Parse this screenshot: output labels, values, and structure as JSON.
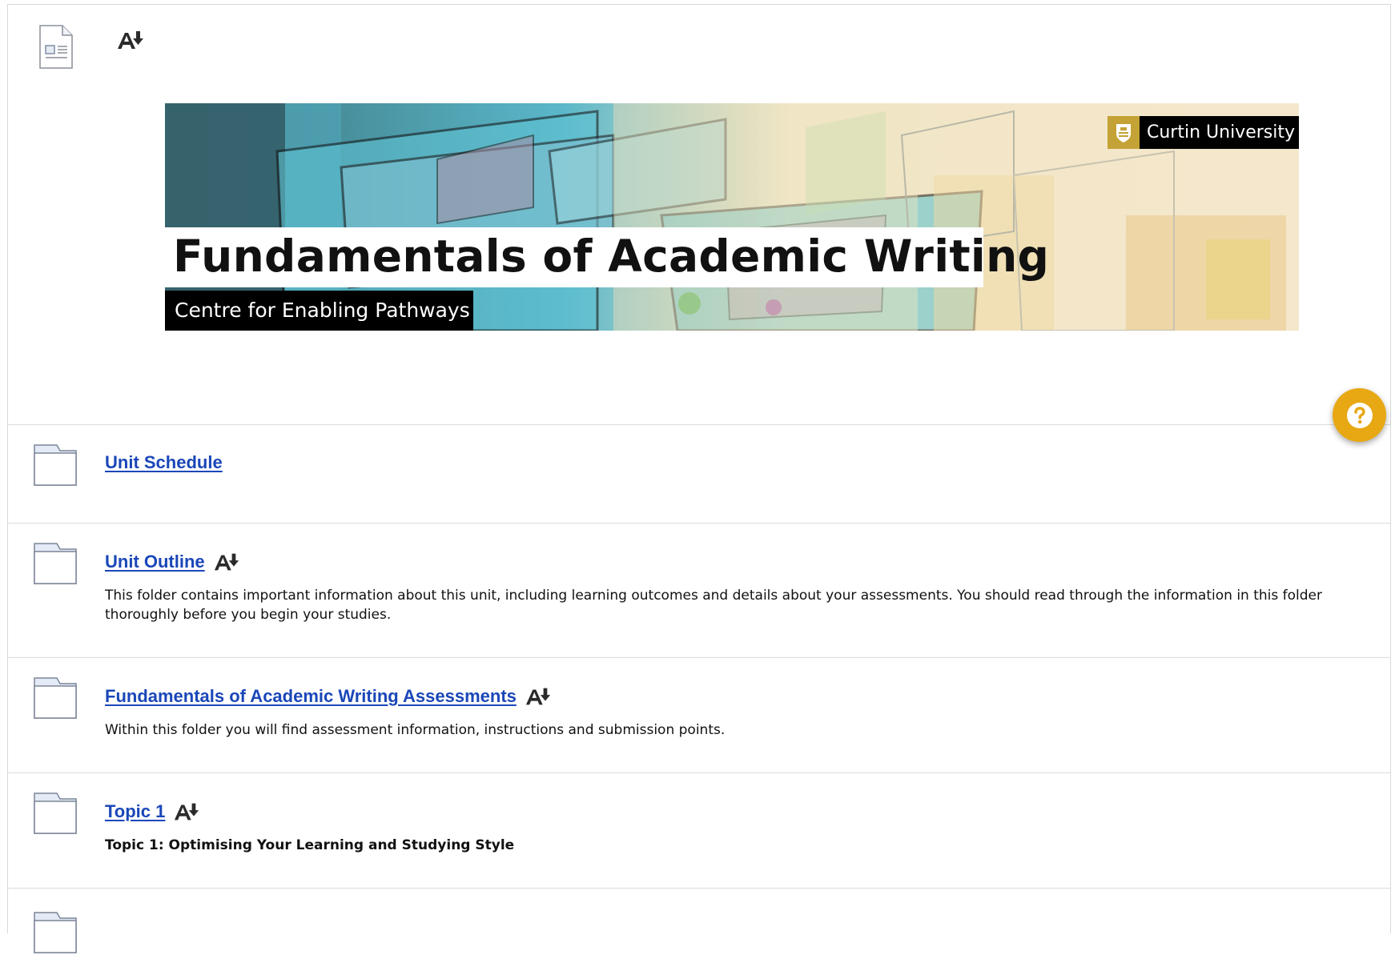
{
  "banner": {
    "title": "Fundamentals of Academic Writing",
    "subtitle": "Centre for Enabling Pathways",
    "logo_text": "Curtin University"
  },
  "help_button": {
    "icon": "question-icon"
  },
  "items": [
    {
      "title": "Unit Schedule",
      "has_alt_formats": false,
      "description": ""
    },
    {
      "title": "Unit Outline",
      "has_alt_formats": true,
      "description": "This folder contains important information about this unit, including learning outcomes and details about your assessments. You should read through the information in this folder thoroughly before you begin your studies."
    },
    {
      "title": "Fundamentals of Academic Writing Assessments",
      "has_alt_formats": true,
      "description": "Within this folder you will find assessment information, instructions and submission points."
    },
    {
      "title": "Topic 1",
      "has_alt_formats": true,
      "description": "Topic 1: Optimising Your Learning and Studying Style"
    }
  ],
  "colors": {
    "link": "#1a47b8",
    "help_button": "#e8a814",
    "divider": "#dcdcdc",
    "curtin_gold": "#c5a235"
  }
}
